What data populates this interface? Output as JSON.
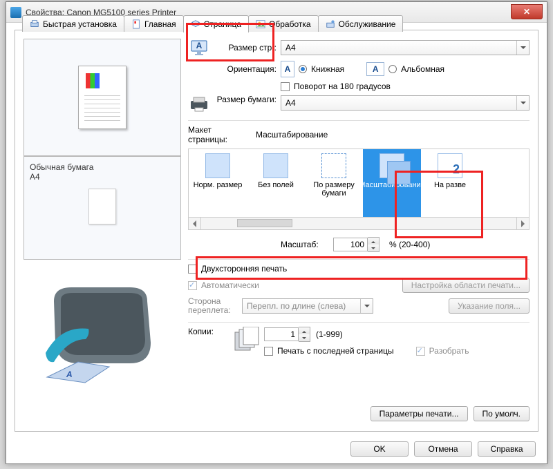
{
  "window": {
    "title": "Свойства: Canon MG5100 series Printer"
  },
  "tabs": {
    "quick": "Быстрая установка",
    "main": "Главная",
    "page": "Страница",
    "proc": "Обработка",
    "maint": "Обслуживание"
  },
  "labels": {
    "page_size": "Размер стр.:",
    "orientation": "Ориентация:",
    "portrait": "Книжная",
    "landscape": "Альбомная",
    "rotate180": "Поворот на 180 градусов",
    "paper_size": "Размер бумаги:",
    "layout": "Макет страницы:",
    "scale": "Масштаб:",
    "scale_range": "% (20-400)",
    "duplex": "Двухсторонняя печать",
    "auto": "Автоматически",
    "binding": "Сторона переплета:",
    "copies": "Копии:",
    "copies_range": "(1-999)",
    "last_page": "Печать с последней страницы",
    "collate": "Разобрать"
  },
  "values": {
    "page_size": "A4",
    "paper_size": "A4",
    "binding": "Перепл. по длине (слева)",
    "scale": "100",
    "copies": "1"
  },
  "layout_items": {
    "selected_caption": "Масштабирование",
    "norm": "Норм. размер",
    "noborder": "Без полей",
    "fit": "По размеру бумаги",
    "scaled": "Масштабирование",
    "pages": "На разве"
  },
  "media": {
    "paper": "Обычная бумага",
    "size": "A4"
  },
  "buttons": {
    "area_setup": "Настройка области печати...",
    "margin": "Указание поля...",
    "print_params": "Параметры печати...",
    "defaults": "По умолч.",
    "ok": "OK",
    "cancel": "Отмена",
    "help": "Справка"
  }
}
